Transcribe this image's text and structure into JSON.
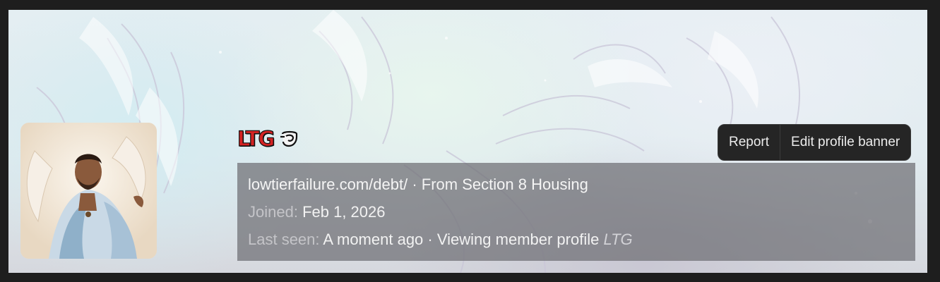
{
  "profile": {
    "username": "LTG",
    "badge_icon": "trophy-emblem-icon",
    "website": "lowtierfailure.com/debt/",
    "separator": "·",
    "location_prefix": "From",
    "location": "Section 8 Housing",
    "joined_label": "Joined:",
    "joined_value": "Feb 1, 2026",
    "last_seen_label": "Last seen:",
    "last_seen_value": "A moment ago",
    "activity_text": "Viewing member profile",
    "activity_target": "LTG"
  },
  "actions": {
    "report_label": "Report",
    "edit_banner_label": "Edit profile banner"
  },
  "colors": {
    "username": "#d42323",
    "action_bg": "#252525",
    "info_box_bg": "rgba(110,110,115,0.72)",
    "page_frame": "#1e1e1e"
  }
}
